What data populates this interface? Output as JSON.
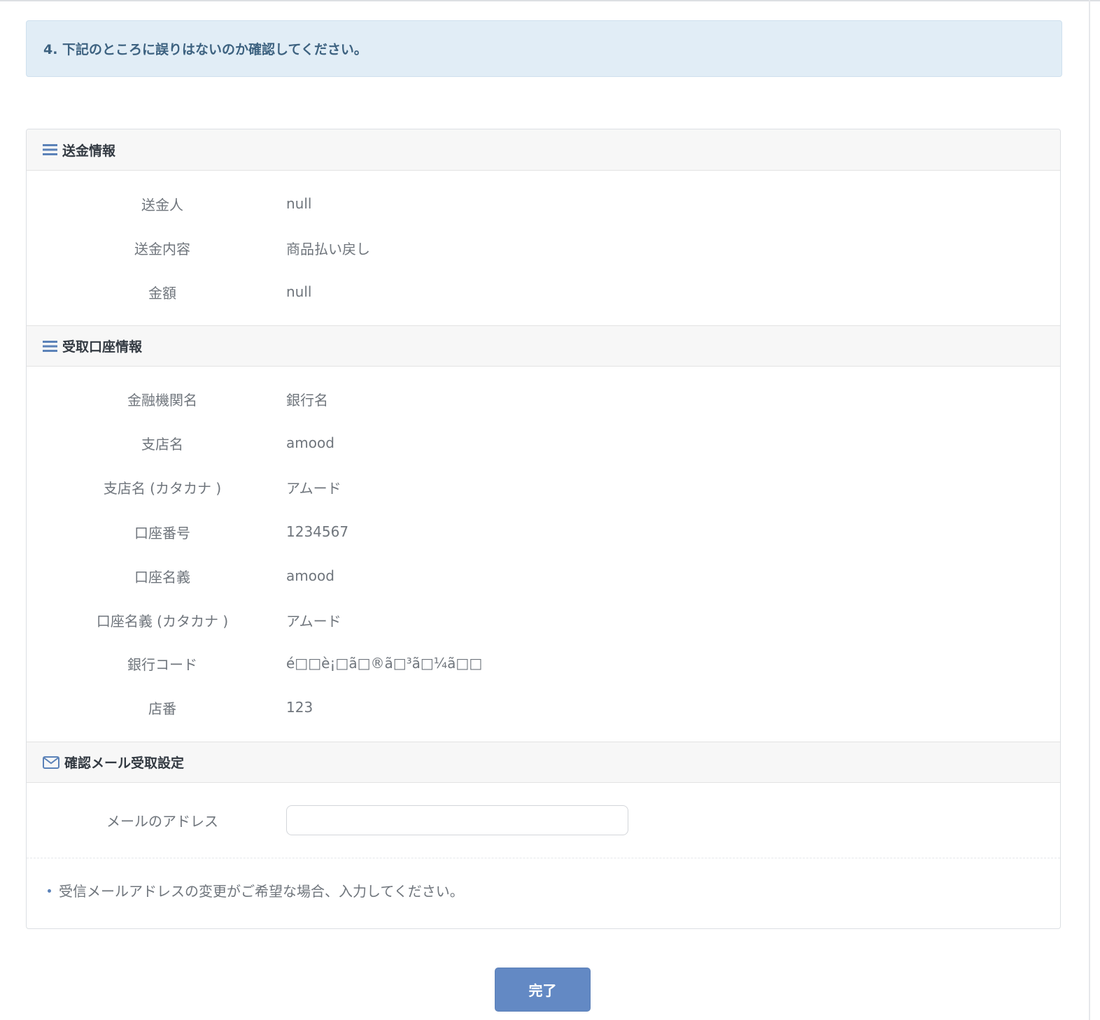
{
  "notice": {
    "text": "4. 下記のところに誤りはないのか確認してください。"
  },
  "sections": {
    "transfer": {
      "title": "送金情報",
      "rows": [
        {
          "label": "送金人",
          "value": "null"
        },
        {
          "label": "送金内容",
          "value": "商品払い戻し"
        },
        {
          "label": "金額",
          "value": "null"
        }
      ]
    },
    "account": {
      "title": "受取口座情報",
      "rows": [
        {
          "label": "金融機関名",
          "value": "銀行名"
        },
        {
          "label": "支店名",
          "value": "amood"
        },
        {
          "label": "支店名 (カタカナ )",
          "value": "アムード"
        },
        {
          "label": "口座番号",
          "value": "1234567"
        },
        {
          "label": "口座名義",
          "value": "amood"
        },
        {
          "label": "口座名義 (カタカナ )",
          "value": "アムード"
        },
        {
          "label": "銀行コード",
          "value": "é□□è¡□ã□®ã□³ã□¼ã□□"
        },
        {
          "label": "店番",
          "value": "123"
        }
      ]
    },
    "email": {
      "title": "確認メール受取設定",
      "address_label": "メールのアドレス",
      "address_value": "",
      "note": "受信メールアドレスの変更がご希望な場合、入力してください。"
    }
  },
  "actions": {
    "done_label": "完了"
  },
  "colors": {
    "accent": "#6389c4",
    "notice_bg": "#e1edf6",
    "icon": "#5b82b8"
  },
  "icons": {
    "list": "list-icon",
    "mail": "envelope-icon"
  }
}
